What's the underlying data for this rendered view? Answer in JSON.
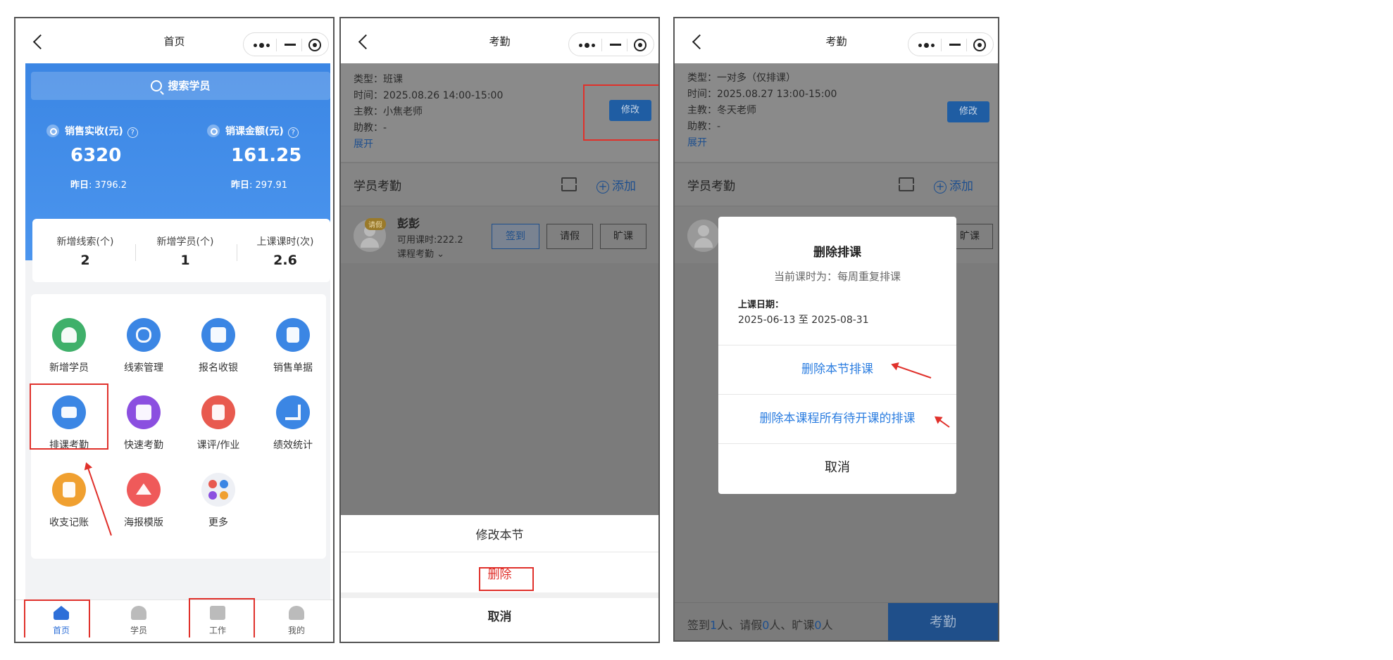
{
  "home": {
    "title": "首页",
    "search": "搜索学员",
    "stats": [
      {
        "label": "销售实收(元)",
        "value": "6320",
        "yesterday_label": "昨日",
        "yesterday": "3796.2"
      },
      {
        "label": "销课金额(元)",
        "value": "161.25",
        "yesterday_label": "昨日",
        "yesterday": "297.91"
      }
    ],
    "counts": [
      {
        "label": "新增线索(个)",
        "value": "2"
      },
      {
        "label": "新增学员(个)",
        "value": "1"
      },
      {
        "label": "上课课时(次)",
        "value": "2.6"
      }
    ],
    "grid": [
      {
        "label": "新增学员",
        "icon": "add-student-icon",
        "color": "#3fb06a"
      },
      {
        "label": "线索管理",
        "icon": "leads-icon",
        "color": "#3b86e4"
      },
      {
        "label": "报名收银",
        "icon": "cashier-icon",
        "color": "#3b86e4"
      },
      {
        "label": "销售单据",
        "icon": "sales-doc-icon",
        "color": "#3b86e4"
      },
      {
        "label": "排课考勤",
        "icon": "schedule-attendance-icon",
        "color": "#3b86e4"
      },
      {
        "label": "快速考勤",
        "icon": "quick-attendance-icon",
        "color": "#8b4fe0"
      },
      {
        "label": "课评/作业",
        "icon": "review-homework-icon",
        "color": "#e85a4f"
      },
      {
        "label": "绩效统计",
        "icon": "performance-chart-icon",
        "color": "#3b86e4"
      },
      {
        "label": "收支记账",
        "icon": "bookkeeping-icon",
        "color": "#f0a030"
      },
      {
        "label": "海报模版",
        "icon": "poster-icon",
        "color": "#ef5a5a"
      },
      {
        "label": "更多",
        "icon": "more-icon",
        "color": "#eef0f5"
      }
    ],
    "tabs": [
      {
        "label": "首页",
        "active": true
      },
      {
        "label": "学员",
        "active": false
      },
      {
        "label": "工作",
        "active": false
      },
      {
        "label": "我的",
        "active": false
      }
    ]
  },
  "attendance1": {
    "title": "考勤",
    "info": [
      "类型：班课",
      "时间：2025.08.26 14:00-15:00",
      "主教：小焦老师",
      "助教：-"
    ],
    "expand": "展开",
    "edit": "修改",
    "section": "学员考勤",
    "add": "添加",
    "student": {
      "name": "彭彭",
      "badge": "请假",
      "hours": "可用课时:222.2",
      "course": "课程考勤"
    },
    "buttons": [
      "签到",
      "请假",
      "旷课"
    ],
    "sheet": {
      "modify": "修改本节",
      "delete": "删除",
      "cancel": "取消"
    }
  },
  "attendance2": {
    "title": "考勤",
    "info": [
      "类型：一对多（仅排课）",
      "时间：2025.08.27 13:00-15:00",
      "主教：冬天老师",
      "助教：-"
    ],
    "expand": "展开",
    "edit": "修改",
    "section": "学员考勤",
    "add": "添加",
    "partial_button": "旷课",
    "modal": {
      "title": "删除排课",
      "subtitle": "当前课时为：每周重复排课",
      "date_label": "上课日期：",
      "date": "2025-06-13 至 2025-08-31",
      "option1": "删除本节排课",
      "option2": "删除本课程所有待开课的排课",
      "cancel": "取消"
    },
    "footer": {
      "p1": "签到",
      "n1": "1",
      "p2": "人、请假",
      "n2": "0",
      "p3": "人、旷课",
      "n3": "0",
      "p4": "人",
      "button": "考勤"
    }
  }
}
